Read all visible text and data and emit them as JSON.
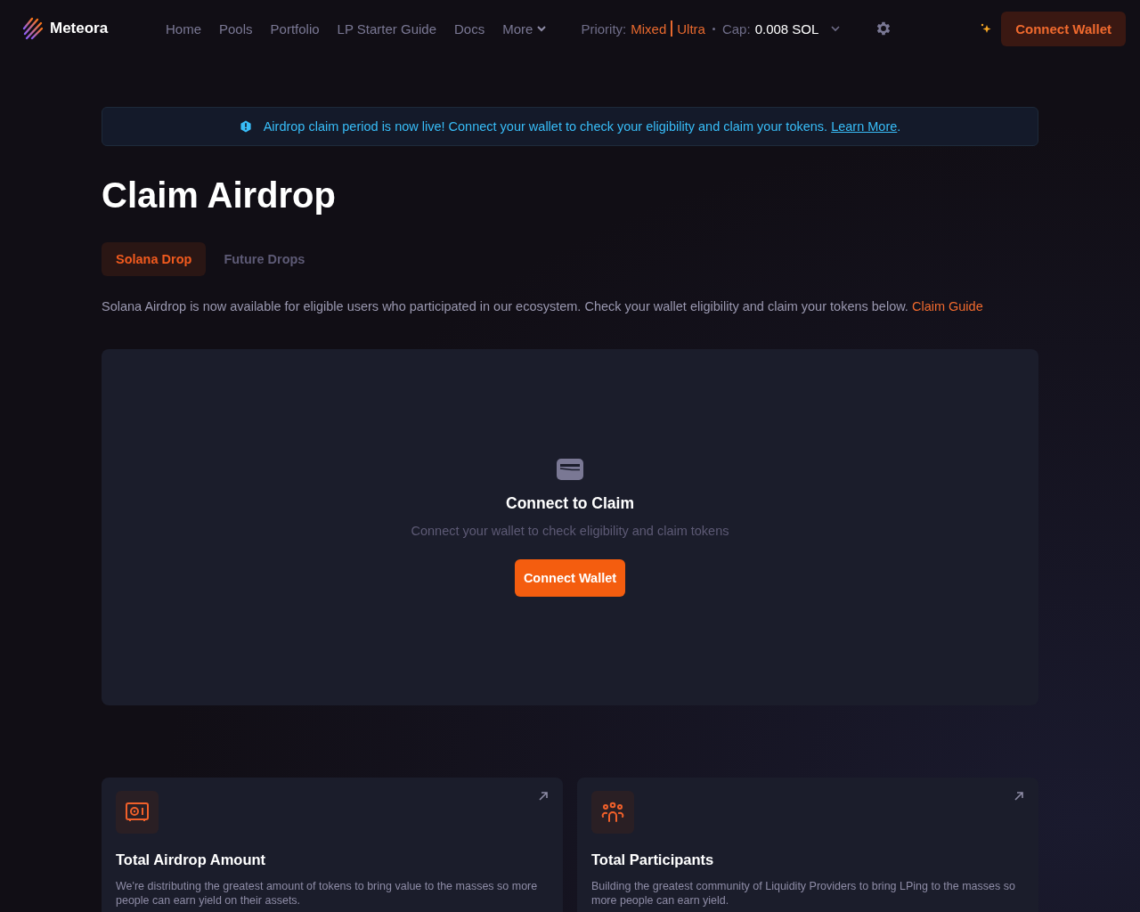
{
  "header": {
    "brand": "Meteora",
    "nav": [
      {
        "label": "Home",
        "dropdown": false
      },
      {
        "label": "Pools",
        "dropdown": false
      },
      {
        "label": "Portfolio",
        "dropdown": false
      },
      {
        "label": "LP Starter Guide",
        "dropdown": false
      },
      {
        "label": "Docs",
        "dropdown": false
      },
      {
        "label": "More",
        "dropdown": true
      }
    ],
    "priority": {
      "label": "Priority:",
      "modes": [
        "Mixed",
        "Ultra"
      ],
      "cap_label": "Cap:",
      "cap_value": "0.008 SOL"
    },
    "connect_button": "Connect Wallet"
  },
  "banner": {
    "text": "Airdrop claim period is now live! Connect your wallet to check your eligibility and claim your tokens.",
    "link": "Learn More",
    "trail": "."
  },
  "title": "Claim Airdrop",
  "tabs": [
    {
      "label": "Solana Drop",
      "selected": true
    },
    {
      "label": "Future Drops",
      "selected": false
    }
  ],
  "description": {
    "text": "Solana Airdrop is now available for eligible users who participated in our ecosystem. Check your wallet eligibility and claim your tokens below.",
    "link": "Claim Guide"
  },
  "claim_panel": {
    "heading": "Connect to Claim",
    "subtext": "Connect your wallet to check eligibility and claim tokens",
    "button": "Connect Wallet"
  },
  "cards": [
    {
      "kind": "vault",
      "title": "Total Airdrop Amount",
      "text": "We're distributing the greatest amount of tokens to bring value to the masses so more people can earn yield on their assets."
    },
    {
      "kind": "people",
      "title": "Total Participants",
      "text": "Building the greatest community of Liquidity Providers to bring LPing to the masses so more people can earn yield."
    }
  ]
}
